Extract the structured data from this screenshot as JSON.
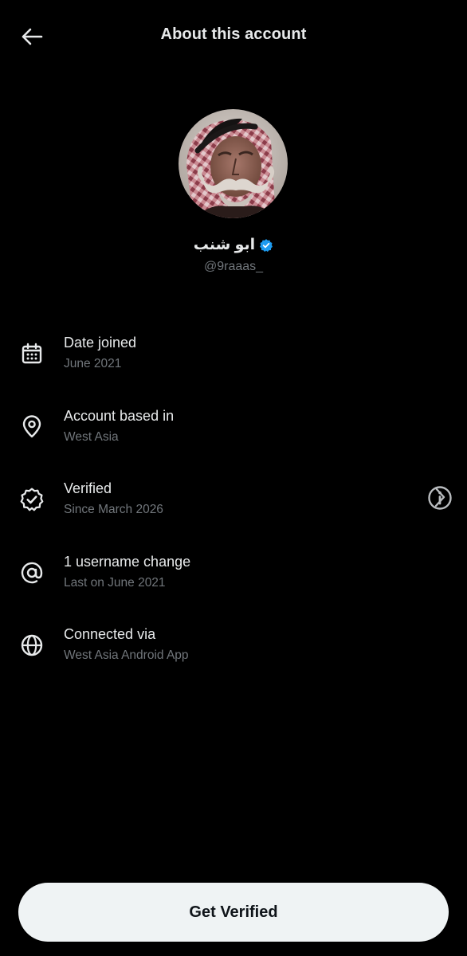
{
  "header": {
    "title": "About this account",
    "back_icon": "arrow-left-icon"
  },
  "profile": {
    "display_name": "ابو شنب",
    "handle": "@9raaas_",
    "verified_badge_color": "#1d9bf0",
    "avatar_description": "profile-avatar"
  },
  "info_items": [
    {
      "icon": "calendar-icon",
      "title": "Date joined",
      "subtitle": "June 2021",
      "trailing": ""
    },
    {
      "icon": "location-pin-icon",
      "title": "Account based in",
      "subtitle": "West Asia",
      "trailing": "info-icon"
    },
    {
      "icon": "verified-seal-icon",
      "title": "Verified",
      "subtitle": "Since March 2026",
      "trailing": "chevron-right-icon"
    },
    {
      "icon": "at-sign-icon",
      "title": "1 username change",
      "subtitle": "Last on June 2021",
      "trailing": ""
    },
    {
      "icon": "globe-icon",
      "title": "Connected via",
      "subtitle": "West Asia Android App",
      "trailing": ""
    }
  ],
  "cta": {
    "label": "Get Verified"
  },
  "colors": {
    "background": "#000000",
    "primary_text": "#e7e9ea",
    "secondary_text": "#71767b",
    "button_bg": "#eff3f4",
    "button_text": "#0f1419"
  }
}
